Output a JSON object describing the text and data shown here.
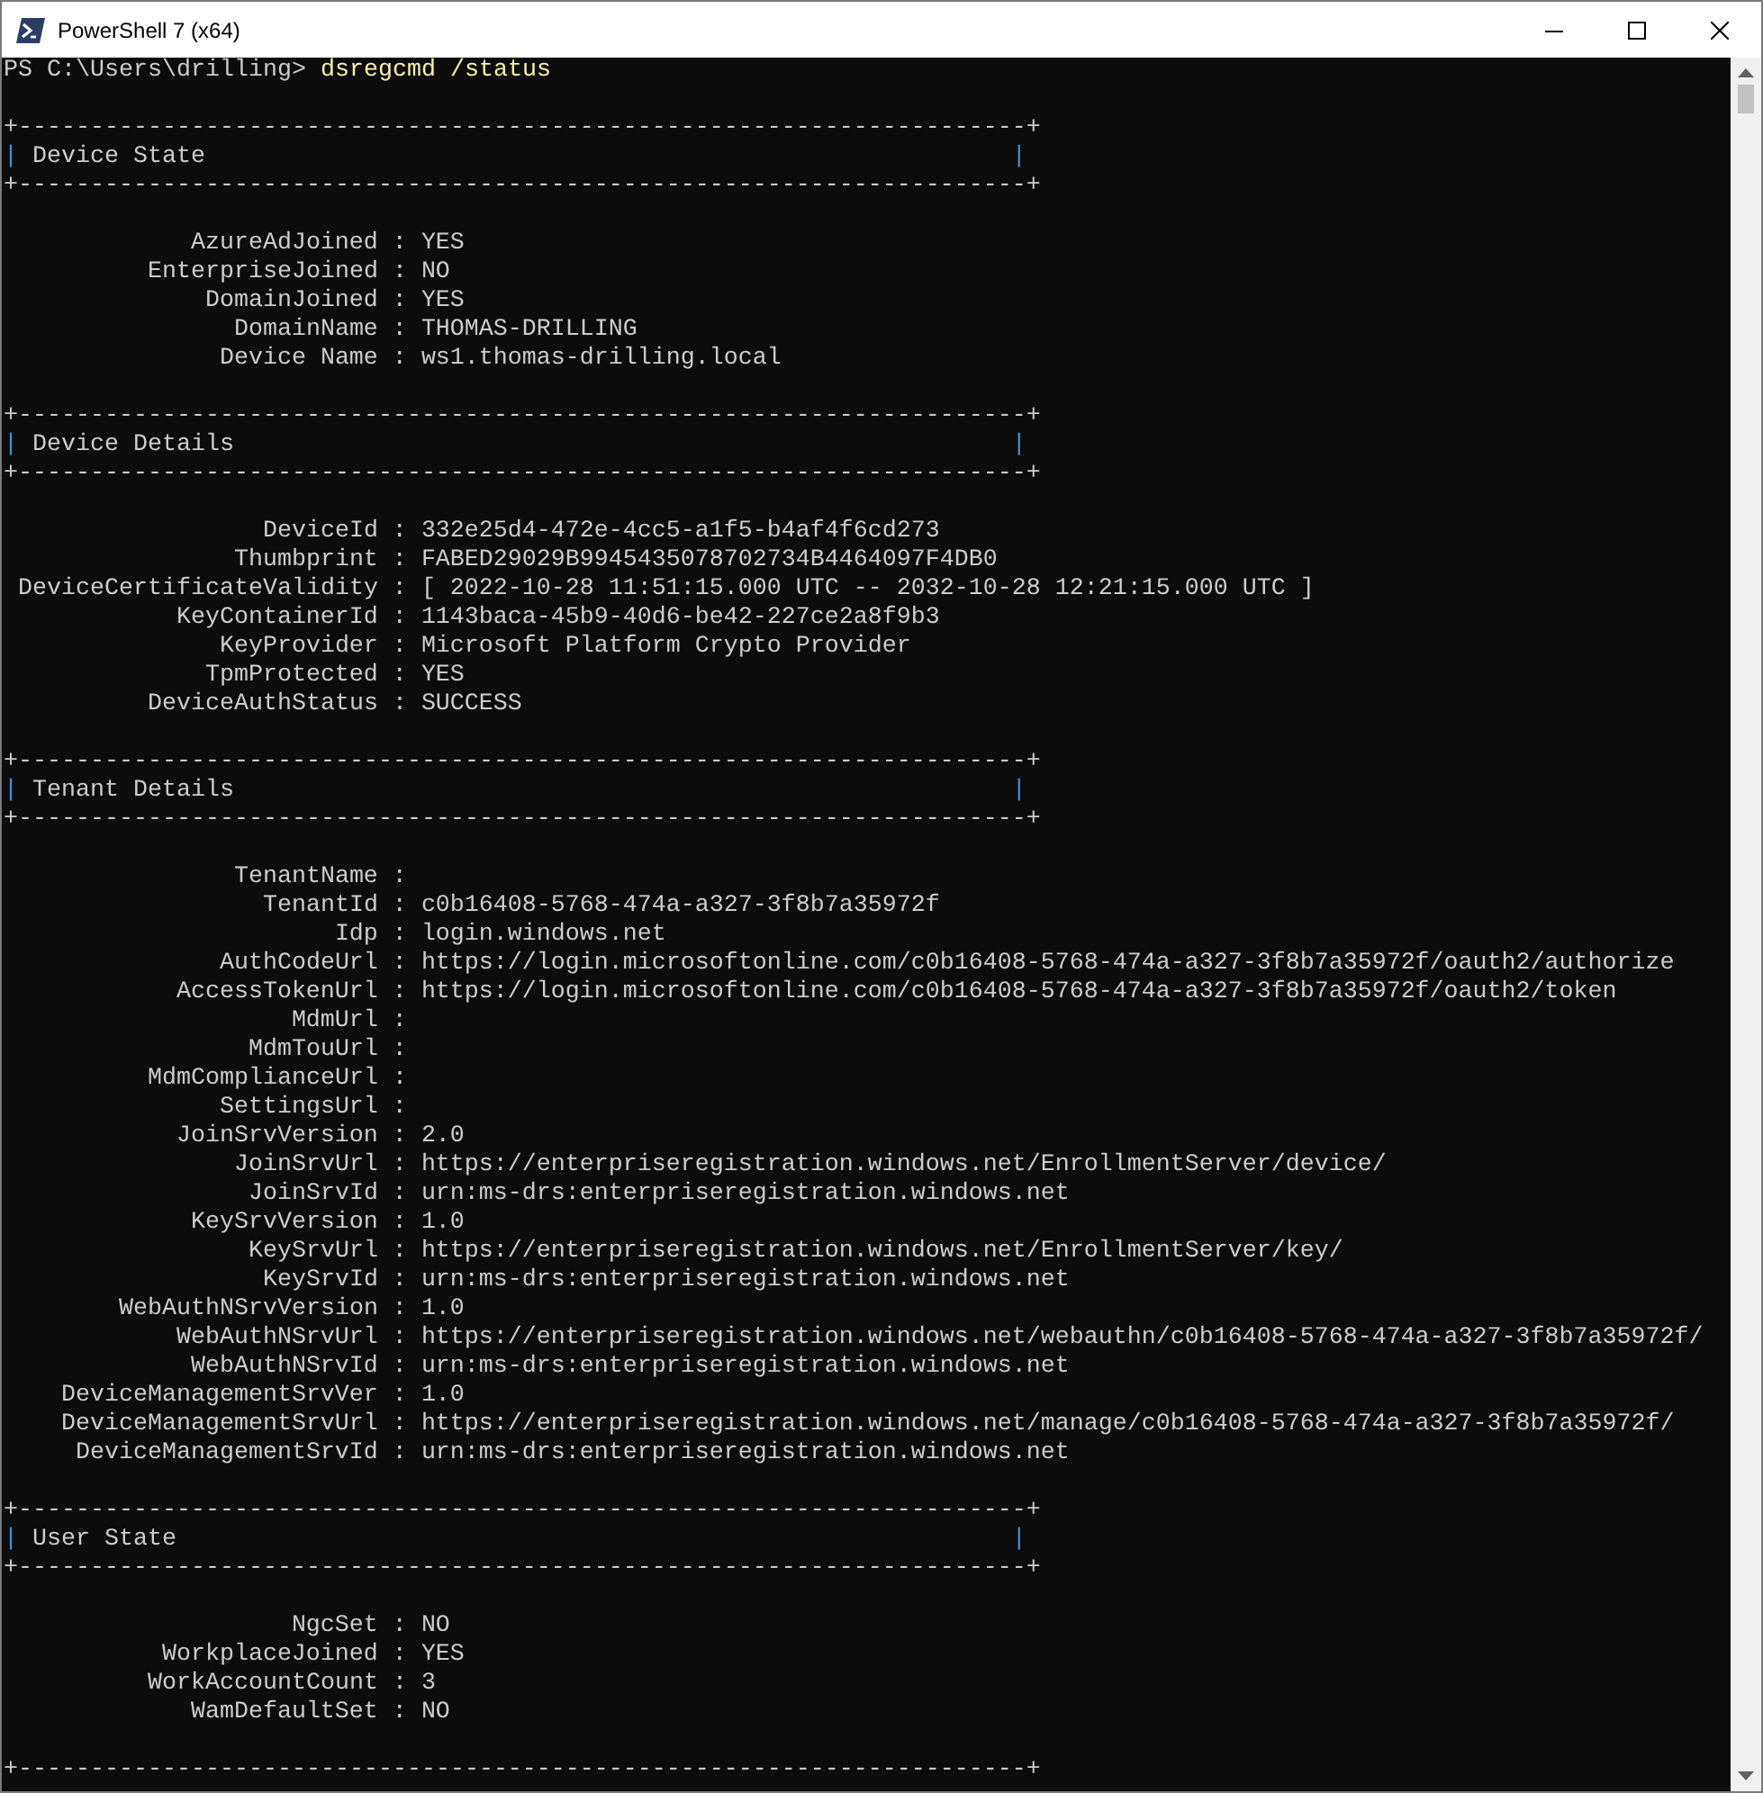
{
  "window": {
    "title": "PowerShell 7 (x64)"
  },
  "prompt": {
    "path": "PS C:\\Users\\drilling>",
    "command": "dsregcmd /status"
  },
  "sections": [
    {
      "border_top": "+----------------------------------------------------------------------+",
      "pipe_left": "|",
      "title": "Device State",
      "pipe_right": "|",
      "border_bottom": "+----------------------------------------------------------------------+",
      "rows": [
        {
          "key": "AzureAdJoined :",
          "value": "YES"
        },
        {
          "key": "EnterpriseJoined :",
          "value": "NO"
        },
        {
          "key": "DomainJoined :",
          "value": "YES"
        },
        {
          "key": "DomainName :",
          "value": "THOMAS-DRILLING"
        },
        {
          "key": "Device Name :",
          "value": "ws1.thomas-drilling.local"
        }
      ]
    },
    {
      "border_top": "+----------------------------------------------------------------------+",
      "pipe_left": "|",
      "title": "Device Details",
      "pipe_right": "|",
      "border_bottom": "+----------------------------------------------------------------------+",
      "rows": [
        {
          "key": "DeviceId :",
          "value": "332e25d4-472e-4cc5-a1f5-b4af4f6cd273"
        },
        {
          "key": "Thumbprint :",
          "value": "FABED29029B9945435078702734B4464097F4DB0"
        },
        {
          "key": "DeviceCertificateValidity :",
          "value": "[ 2022-10-28 11:51:15.000 UTC -- 2032-10-28 12:21:15.000 UTC ]"
        },
        {
          "key": "KeyContainerId :",
          "value": "1143baca-45b9-40d6-be42-227ce2a8f9b3"
        },
        {
          "key": "KeyProvider :",
          "value": "Microsoft Platform Crypto Provider"
        },
        {
          "key": "TpmProtected :",
          "value": "YES"
        },
        {
          "key": "DeviceAuthStatus :",
          "value": "SUCCESS"
        }
      ]
    },
    {
      "border_top": "+----------------------------------------------------------------------+",
      "pipe_left": "|",
      "title": "Tenant Details",
      "pipe_right": "|",
      "border_bottom": "+----------------------------------------------------------------------+",
      "rows": [
        {
          "key": "TenantName :"
        },
        {
          "key": "TenantId :",
          "value": "c0b16408-5768-474a-a327-3f8b7a35972f"
        },
        {
          "key": "Idp :",
          "value": "login.windows.net"
        },
        {
          "key": "AuthCodeUrl :",
          "value": "https://login.microsoftonline.com/c0b16408-5768-474a-a327-3f8b7a35972f/oauth2/authorize"
        },
        {
          "key": "AccessTokenUrl :",
          "value": "https://login.microsoftonline.com/c0b16408-5768-474a-a327-3f8b7a35972f/oauth2/token"
        },
        {
          "key": "MdmUrl :"
        },
        {
          "key": "MdmTouUrl :"
        },
        {
          "key": "MdmComplianceUrl :"
        },
        {
          "key": "SettingsUrl :"
        },
        {
          "key": "JoinSrvVersion :",
          "value": "2.0"
        },
        {
          "key": "JoinSrvUrl :",
          "value": "https://enterpriseregistration.windows.net/EnrollmentServer/device/"
        },
        {
          "key": "JoinSrvId :",
          "value": "urn:ms-drs:enterpriseregistration.windows.net"
        },
        {
          "key": "KeySrvVersion :",
          "value": "1.0"
        },
        {
          "key": "KeySrvUrl :",
          "value": "https://enterpriseregistration.windows.net/EnrollmentServer/key/"
        },
        {
          "key": "KeySrvId :",
          "value": "urn:ms-drs:enterpriseregistration.windows.net"
        },
        {
          "key": "WebAuthNSrvVersion :",
          "value": "1.0"
        },
        {
          "key": "WebAuthNSrvUrl :",
          "value": "https://enterpriseregistration.windows.net/webauthn/c0b16408-5768-474a-a327-3f8b7a35972f/"
        },
        {
          "key": "WebAuthNSrvId :",
          "value": "urn:ms-drs:enterpriseregistration.windows.net"
        },
        {
          "key": "DeviceManagementSrvVer :",
          "value": "1.0"
        },
        {
          "key": "DeviceManagementSrvUrl :",
          "value": "https://enterpriseregistration.windows.net/manage/c0b16408-5768-474a-a327-3f8b7a35972f/"
        },
        {
          "key": "DeviceManagementSrvId :",
          "value": "urn:ms-drs:enterpriseregistration.windows.net"
        }
      ]
    },
    {
      "border_top": "+----------------------------------------------------------------------+",
      "pipe_left": "|",
      "title": "User State",
      "pipe_right": "|",
      "border_bottom": "+----------------------------------------------------------------------+",
      "rows": [
        {
          "key": "NgcSet :",
          "value": "NO"
        },
        {
          "key": "WorkplaceJoined :",
          "value": "YES"
        },
        {
          "key": "WorkAccountCount :",
          "value": "3"
        },
        {
          "key": "WamDefaultSet :",
          "value": "NO"
        }
      ]
    }
  ],
  "trailing_border": "+----------------------------------------------------------------------+"
}
